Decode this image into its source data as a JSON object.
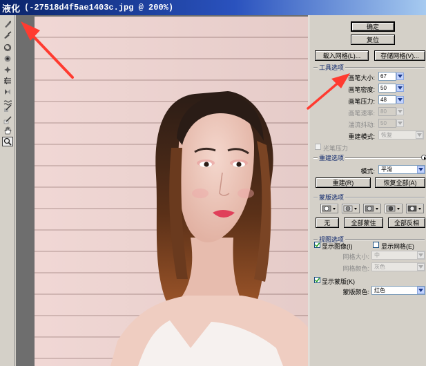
{
  "window": {
    "app_title": "液化",
    "doc_title": "(-27518d4f5ae1403c.jpg @ 200%)"
  },
  "toolbox": {
    "tools": [
      "forward-warp",
      "reconstruct",
      "twirl-clockwise",
      "pucker",
      "bloat",
      "push-left",
      "mirror",
      "turbulence",
      "freeze-mask",
      "thaw-mask",
      "hand",
      "zoom"
    ]
  },
  "panel": {
    "ok_label": "确定",
    "reset_label": "复位",
    "load_mesh_label": "载入网格(L)...",
    "save_mesh_label": "存储网格(V)...",
    "tool_options": {
      "title": "工具选项",
      "brush_size": {
        "label": "画笔大小:",
        "value": "67"
      },
      "brush_density": {
        "label": "画笔密度:",
        "value": "50"
      },
      "brush_pressure": {
        "label": "画笔压力:",
        "value": "48"
      },
      "brush_rate": {
        "label": "画笔速率:",
        "value": "80"
      },
      "turbulent_jitter": {
        "label": "湍流抖动:",
        "value": "50"
      },
      "reconstruct_mode": {
        "label": "重建模式:",
        "value": "恢复"
      },
      "stylus_label": "光笔压力"
    },
    "reconstruct_options": {
      "title": "重建选项",
      "mode_label": "模式:",
      "mode_value": "平滑",
      "reconstruct_label": "重建(R)",
      "restore_all_label": "恢复全部(A)"
    },
    "mask_options": {
      "title": "蒙版选项",
      "none_label": "无",
      "mask_all_label": "全部蒙住",
      "invert_all_label": "全部反相"
    },
    "view_options": {
      "title": "视图选项",
      "show_image_label": "显示图像(I)",
      "show_mesh_label": "显示网格(E)",
      "mesh_size": {
        "label": "网格大小:",
        "value": "中"
      },
      "mesh_color": {
        "label": "网格颜色:",
        "value": "灰色"
      },
      "show_mask_label": "显示蒙版(K)",
      "mask_color": {
        "label": "蒙版颜色:",
        "value": "红色"
      }
    }
  },
  "colors": {
    "title_bar": "#0a246a",
    "section_title": "#0a246a",
    "annotation_arrow": "#ff3b30",
    "canvas_wall": "#efd4d1"
  }
}
